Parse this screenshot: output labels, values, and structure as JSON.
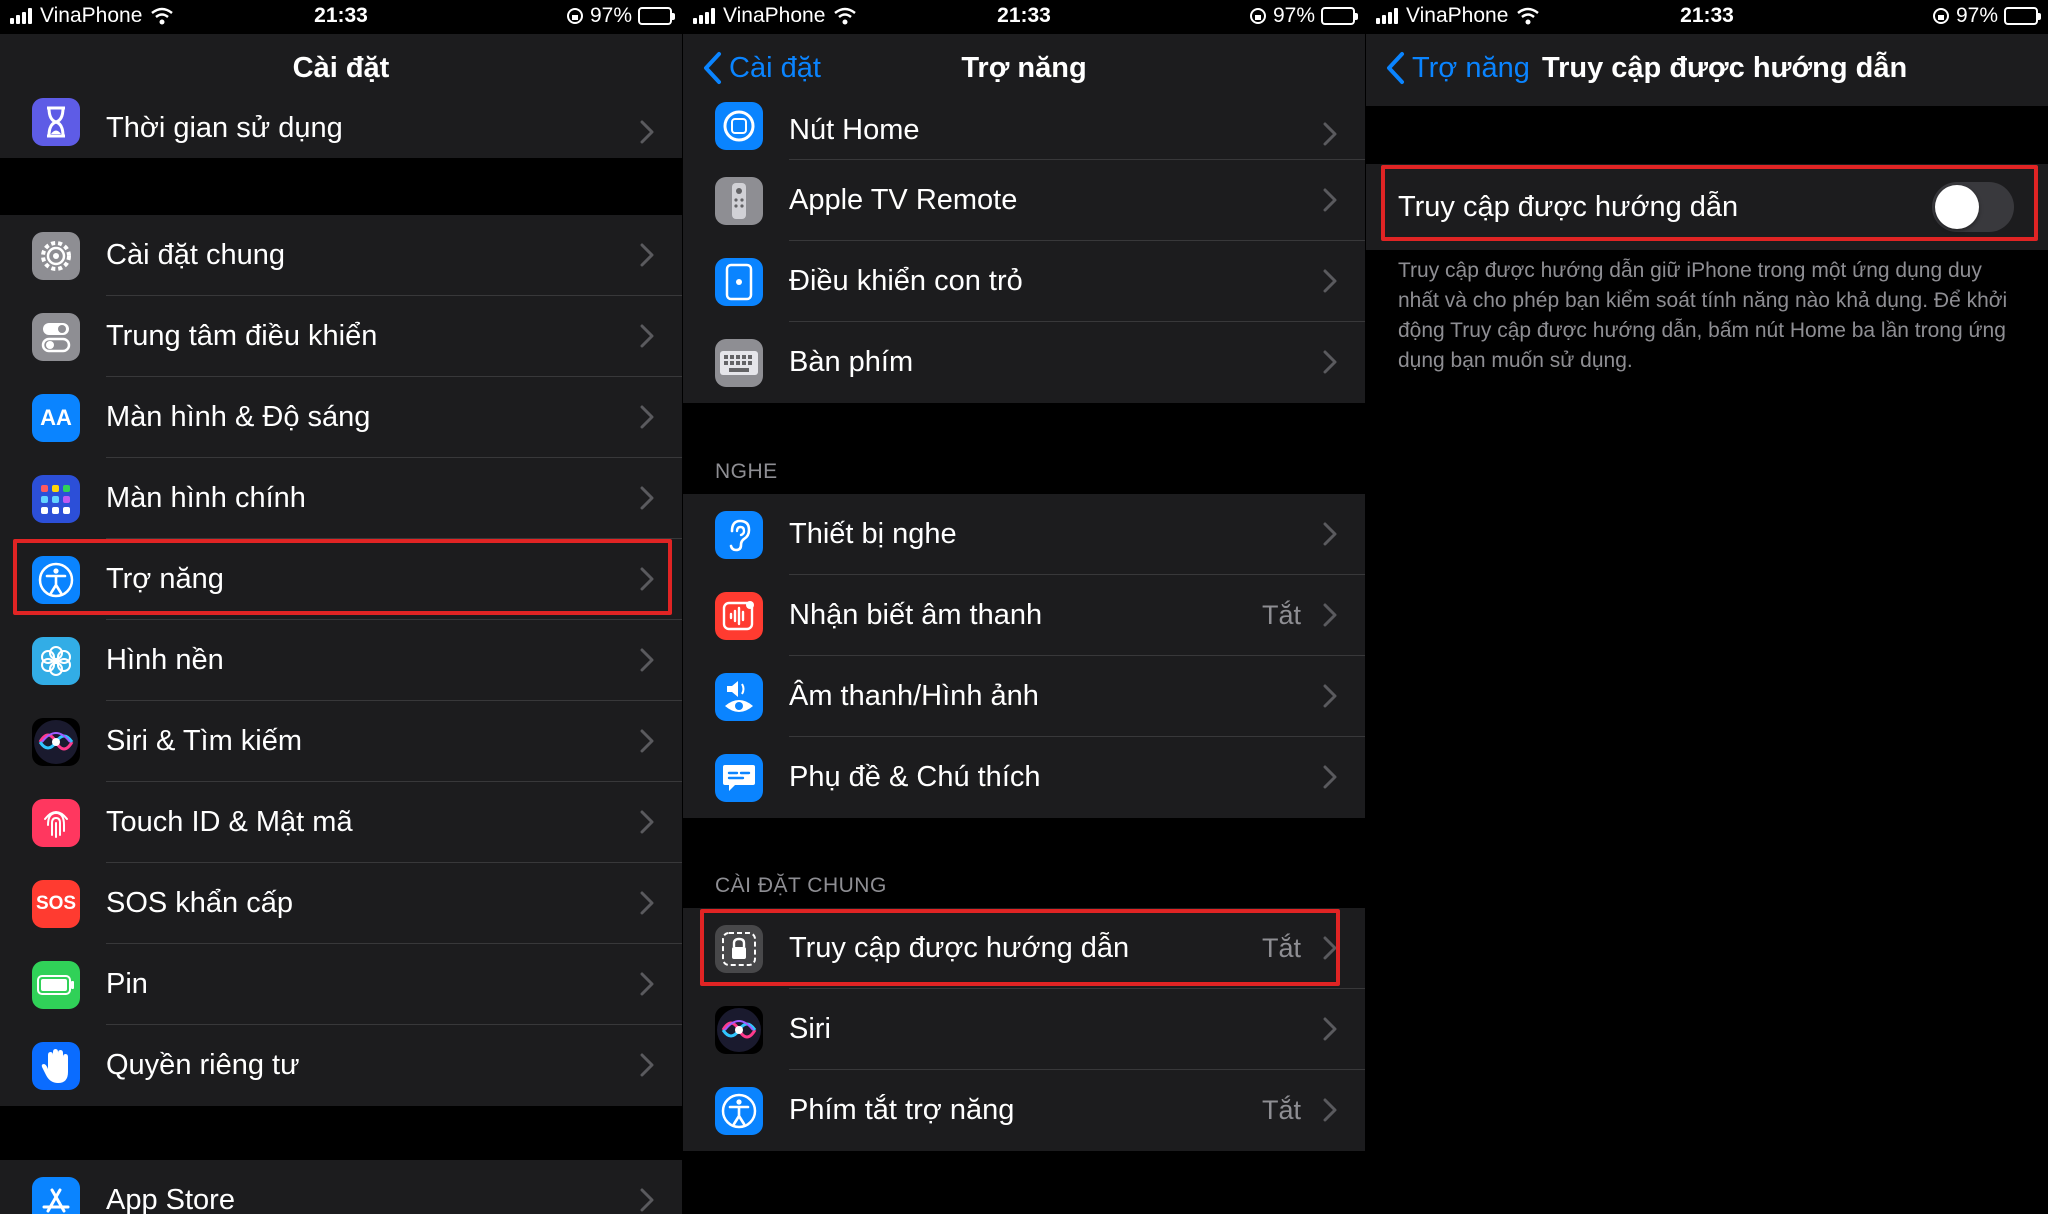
{
  "status": {
    "carrier": "VinaPhone",
    "time": "21:33",
    "battery": "97%"
  },
  "panel1": {
    "title": "Cài đặt",
    "rows_top": [
      {
        "label": "Thời gian sử dụng",
        "icon": "hourglass-icon"
      }
    ],
    "rows_main": [
      {
        "label": "Cài đặt chung",
        "icon": "gear-icon"
      },
      {
        "label": "Trung tâm điều khiển",
        "icon": "switches-icon"
      },
      {
        "label": "Màn hình & Độ sáng",
        "icon": "text-size-icon"
      },
      {
        "label": "Màn hình chính",
        "icon": "home-grid-icon"
      },
      {
        "label": "Trợ năng",
        "icon": "accessibility-icon"
      },
      {
        "label": "Hình nền",
        "icon": "flower-icon"
      },
      {
        "label": "Siri & Tìm kiếm",
        "icon": "siri-icon"
      },
      {
        "label": "Touch ID & Mật mã",
        "icon": "fingerprint-icon"
      },
      {
        "label": "SOS khẩn cấp",
        "icon": "sos-icon"
      },
      {
        "label": "Pin",
        "icon": "battery-icon"
      },
      {
        "label": "Quyền riêng tư",
        "icon": "hand-icon"
      }
    ],
    "rows_bottom": [
      {
        "label": "App Store",
        "icon": "app-store-icon"
      }
    ],
    "sos_text": "SOS",
    "aa_text": "AA"
  },
  "panel2": {
    "back": "Cài đặt",
    "title": "Trợ năng",
    "rows_top": [
      {
        "label": "Nút Home",
        "icon": "home-button-icon"
      },
      {
        "label": "Apple TV Remote",
        "icon": "remote-icon"
      },
      {
        "label": "Điều khiển con trỏ",
        "icon": "pointer-icon"
      },
      {
        "label": "Bàn phím",
        "icon": "keyboard-icon"
      }
    ],
    "section_hearing": "NGHE",
    "rows_hearing": [
      {
        "label": "Thiết bị nghe",
        "icon": "ear-icon",
        "value": ""
      },
      {
        "label": "Nhận biết âm thanh",
        "icon": "sound-recognition-icon",
        "value": "Tắt"
      },
      {
        "label": "Âm thanh/Hình ảnh",
        "icon": "audio-visual-icon",
        "value": ""
      },
      {
        "label": "Phụ đề & Chú thích",
        "icon": "captions-icon",
        "value": ""
      }
    ],
    "section_general": "CÀI ĐẶT CHUNG",
    "rows_general": [
      {
        "label": "Truy cập được hướng dẫn",
        "icon": "lock-icon",
        "value": "Tắt"
      },
      {
        "label": "Siri",
        "icon": "siri-icon",
        "value": ""
      },
      {
        "label": "Phím tắt trợ năng",
        "icon": "accessibility-icon",
        "value": "Tắt"
      }
    ]
  },
  "panel3": {
    "back": "Trợ năng",
    "title": "Truy cập được hướng dẫn",
    "toggle_label": "Truy cập được hướng dẫn",
    "toggle_on": false,
    "description": "Truy cập được hướng dẫn giữ iPhone trong một ứng dụng duy nhất và cho phép bạn kiểm soát tính năng nào khả dụng. Để khởi động Truy cập được hướng dẫn, bấm nút Home ba lần trong ứng dụng bạn muốn sử dụng."
  },
  "colors": {
    "accent": "#0a84ff",
    "highlight": "#e02424",
    "cell": "#1c1c1e",
    "secondary_text": "#8e8e93"
  }
}
